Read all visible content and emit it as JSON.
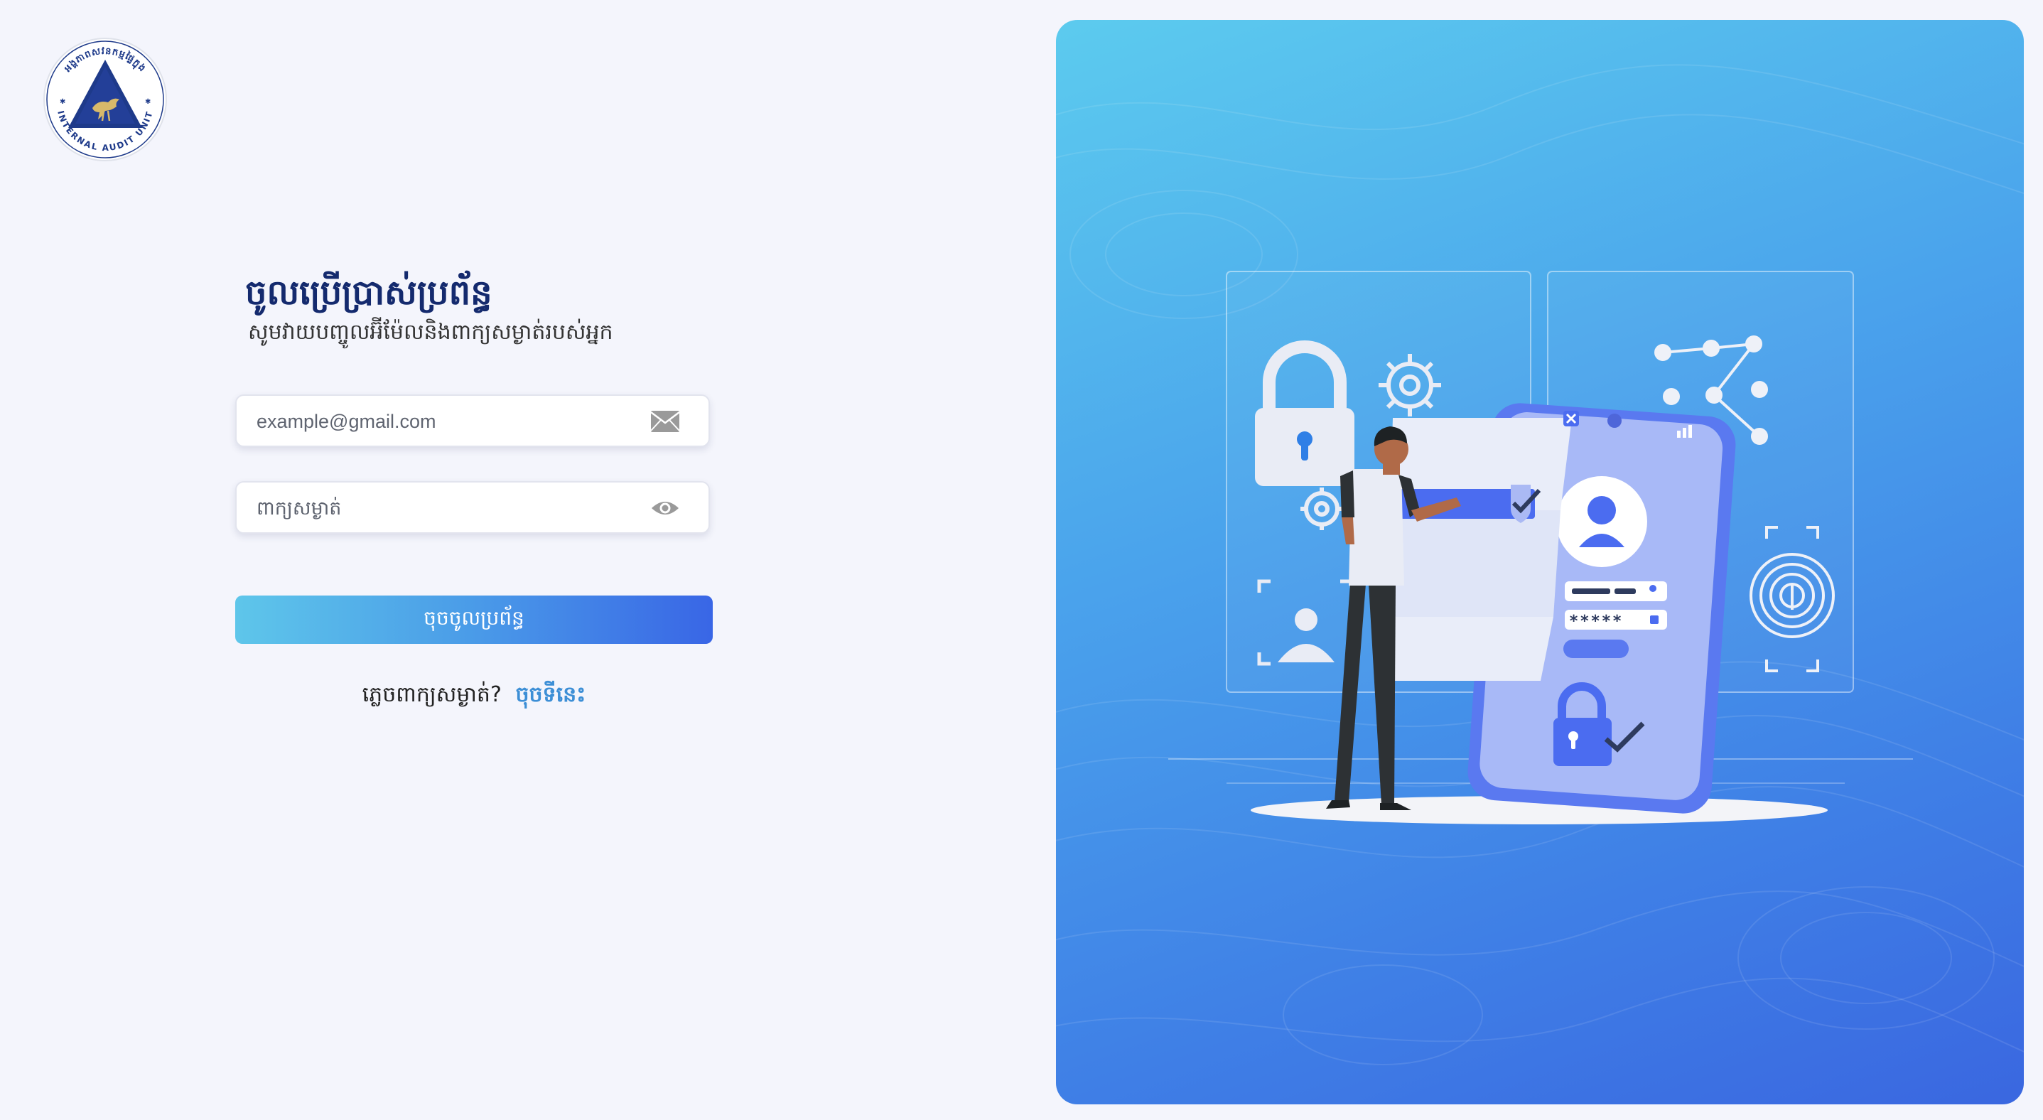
{
  "logo": {
    "ring_text": "INTERNAL AUDIT UNIT",
    "khmer_arc_text": "អង្គភាពសវនកម្មផ្ទៃក្នុង"
  },
  "login": {
    "title": "ចូលប្រើប្រាស់ប្រព័ន្ធ",
    "subtitle": "សូមវាយបញ្ចូលអ៊ីម៉ែលនិងពាក្យសម្ងាត់របស់អ្នក",
    "email_placeholder": "example@gmail.com",
    "email_value": "",
    "password_placeholder": "ពាក្យសម្ងាត់",
    "password_value": "",
    "submit_label": "ចុចចូលប្រព័ន្ធ",
    "forgot_text": "ភ្លេចពាក្យសម្ងាត់?",
    "forgot_link": "ចុចទីនេះ"
  },
  "icons": {
    "email": "envelope-icon",
    "password_toggle": "eye-icon"
  },
  "illustration": {
    "password_mask": "*****"
  },
  "colors": {
    "brand_navy": "#142a6e",
    "accent_blue": "#3d8fd6",
    "button_start": "#5ec6ea",
    "button_end": "#3966e6",
    "page_bg": "#f4f5fc"
  }
}
